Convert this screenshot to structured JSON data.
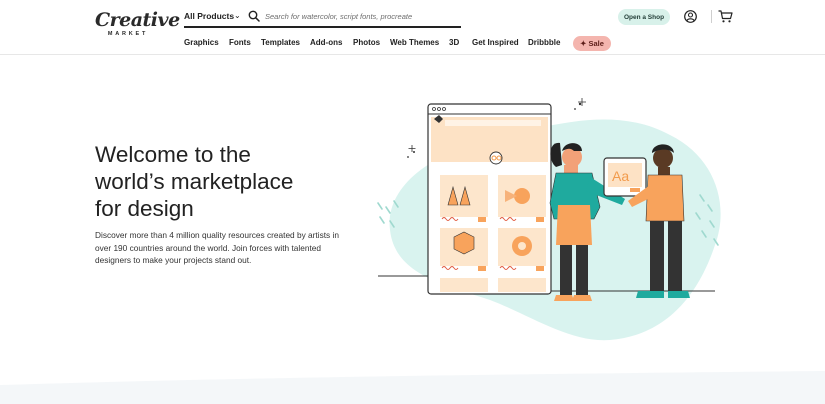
{
  "header": {
    "logo": {
      "main": "Creative",
      "sub": "MARKET"
    },
    "search": {
      "category": "All Products",
      "placeholder": "Search for watercolor, script fonts, procreate"
    },
    "open_shop_label": "Open a Shop",
    "icons": {
      "search": "search-icon",
      "user": "user-icon",
      "cart": "cart-icon",
      "chevron": "chevron-down-icon"
    }
  },
  "nav": {
    "items": [
      "Graphics",
      "Fonts",
      "Templates",
      "Add-ons",
      "Photos",
      "Web Themes",
      "3D",
      "Get Inspired",
      "Dribbble"
    ],
    "sale_label": "✦ Sale"
  },
  "hero": {
    "title_line1": "Welcome to the",
    "title_line2": "world’s marketplace",
    "title_line3": "for design",
    "description": "Discover more than 4 million quality resources created by artists in over 190 countries around the world. Join forces with talented designers to make your projects stand out.",
    "card_text": "Aa"
  },
  "colors": {
    "accent_mint": "#d8f1ea",
    "sale_pink": "#f4b5ae",
    "highlight": "#fde2b8",
    "blob": "#d9f3ef",
    "orange": "#f8a35c"
  }
}
